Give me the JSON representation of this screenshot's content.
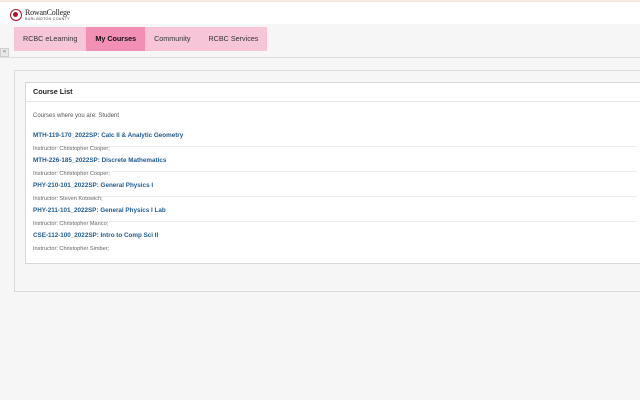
{
  "header": {
    "logo_line1": "RowanCollege",
    "logo_line2": "BURLINGTON COUNTY"
  },
  "nav": {
    "items": [
      {
        "label": "RCBC eLearning"
      },
      {
        "label": "My Courses"
      },
      {
        "label": "Community"
      },
      {
        "label": "RCBC Services"
      }
    ],
    "active_index": 1
  },
  "sidebar_toggle": {
    "glyph": "«"
  },
  "course_list": {
    "title": "Course List",
    "intro": "Courses where you are: Student",
    "courses": [
      {
        "name": "MTH-119-170_2022SP: Calc II & Analytic Geometry",
        "instructor": "Instructor: Christopher Cooper;"
      },
      {
        "name": "MTH-226-185_2022SP: Discrete Mathematics",
        "instructor": "Instructor: Christopher Cooper;"
      },
      {
        "name": "PHY-210-101_2022SP: General Physics I",
        "instructor": "Instructor: Steven Kotowich;"
      },
      {
        "name": "PHY-211-101_2022SP: General Physics I Lab",
        "instructor": "Instructor: Christopher Manco;"
      },
      {
        "name": "CSE-112-100_2022SP: Intro to Comp Sci II",
        "instructor": "Instructor: Christopher Simber;"
      }
    ]
  },
  "colors": {
    "nav_tab": "#f6c6d8",
    "nav_active": "#f28fb5",
    "link": "#1f5b8e",
    "brand": "#b11226"
  }
}
